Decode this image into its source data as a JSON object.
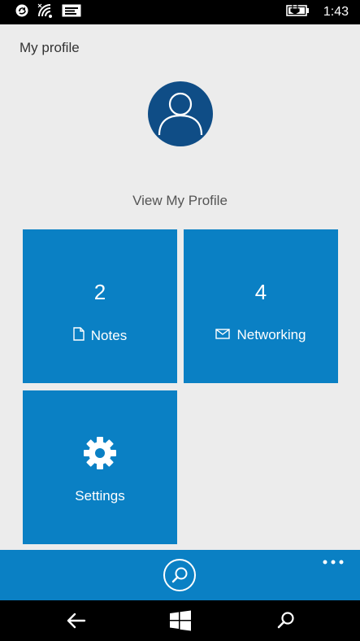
{
  "status_bar": {
    "time": "1:43",
    "icons": [
      "sync-icon",
      "wifi-icon",
      "message-icon",
      "battery-charging-icon"
    ]
  },
  "page": {
    "title": "My profile",
    "view_profile_label": "View My Profile",
    "avatar_icon": "person-icon"
  },
  "tiles": {
    "notes": {
      "count": "2",
      "label": "Notes",
      "icon": "document-icon"
    },
    "networking": {
      "count": "4",
      "label": "Networking",
      "icon": "envelope-icon"
    },
    "settings": {
      "label": "Settings",
      "icon": "gear-icon"
    }
  },
  "app_bar": {
    "search_icon": "search-icon",
    "more_icon": "more-icon"
  },
  "nav_bar": {
    "icons": [
      "back-icon",
      "windows-start-icon",
      "search-icon"
    ]
  },
  "colors": {
    "tile_blue": "#0a80c4",
    "avatar_blue": "#0f4d86",
    "background": "#ececec",
    "status_bar": "#000000"
  }
}
